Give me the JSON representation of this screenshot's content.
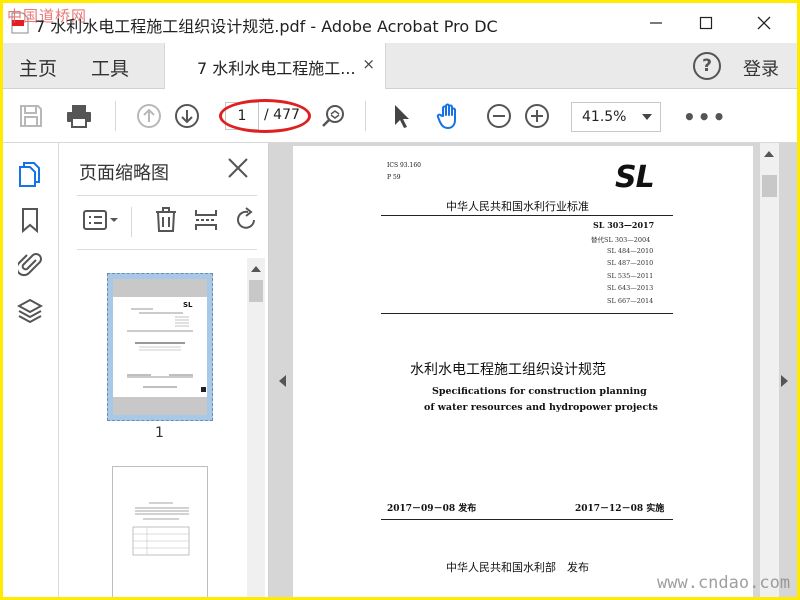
{
  "window": {
    "title": "7 水利水电工程施工组织设计规范.pdf - Adobe Acrobat Pro DC",
    "watermark_top": "中国道桥网",
    "watermark_bottom": "www.cndao.com"
  },
  "tabs": {
    "home": "主页",
    "tools": "工具",
    "document": "7 水利水电工程施工...",
    "close": "×",
    "help": "?",
    "login": "登录"
  },
  "toolbar": {
    "current_page": "1",
    "total_pages": "/ 477",
    "zoom": "41.5%",
    "more": "•••",
    "icons": [
      "save-icon",
      "print-icon",
      "page-up-icon",
      "page-down-icon",
      "zoom-marquee-icon",
      "select-arrow-icon",
      "hand-icon",
      "zoom-out-icon",
      "zoom-in-icon"
    ]
  },
  "thumbnail_panel": {
    "title": "页面缩略图",
    "page1_label": "1"
  },
  "document_page": {
    "ics": "ICS 93.160",
    "p_code": "P 59",
    "logo": "SL",
    "standard_title": "中华人民共和国水利行业标准",
    "code": "SL 303—2017",
    "replaces": [
      "替代SL 303—2004",
      "SL 484—2010",
      "SL 487—2010",
      "SL 535—2011",
      "SL 643—2013",
      "SL 667—2014"
    ],
    "title_cn": "水利水电工程施工组织设计规范",
    "title_en_1": "Specifications for construction planning",
    "title_en_2": "of water resources and hydropower projects",
    "issue_date": "2017－09－08 发布",
    "impl_date": "2017－12－08 实施",
    "publisher": "中华人民共和国水利部　发布"
  },
  "colors": {
    "accent": "#1473e6",
    "highlight": "#e02020",
    "frame": "#ffea00"
  }
}
